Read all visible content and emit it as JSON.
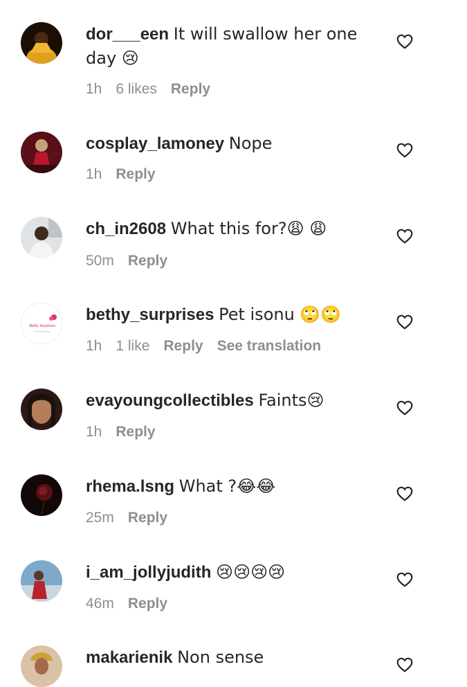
{
  "comments": [
    {
      "username": "dor___een",
      "text": "It will swallow her one day 😢",
      "time": "1h",
      "likes": "6 likes",
      "reply": "Reply",
      "extra": ""
    },
    {
      "username": "cosplay_lamoney",
      "text": "Nope",
      "time": "1h",
      "likes": "",
      "reply": "Reply",
      "extra": ""
    },
    {
      "username": "ch_in2608",
      "text": "What this for?😩 😩",
      "time": "50m",
      "likes": "",
      "reply": "Reply",
      "extra": ""
    },
    {
      "username": "bethy_surprises",
      "text": "Pet isonu 🙄🙄",
      "time": "1h",
      "likes": "1 like",
      "reply": "Reply",
      "extra": "See translation"
    },
    {
      "username": "evayoungcollectibles",
      "text": "Faints😢",
      "time": "1h",
      "likes": "",
      "reply": "Reply",
      "extra": ""
    },
    {
      "username": "rhema.lsng",
      "text": "What ?😂😂",
      "time": "25m",
      "likes": "",
      "reply": "Reply",
      "extra": ""
    },
    {
      "username": "i_am_jollyjudith",
      "text": "😢😢😢😢",
      "time": "46m",
      "likes": "",
      "reply": "Reply",
      "extra": ""
    },
    {
      "username": "makarienik",
      "text": "Non sense",
      "time": "",
      "likes": "",
      "reply": "",
      "extra": ""
    }
  ],
  "avatar_logo_text": "Bethy Surprises",
  "icons": {
    "like": "heart-outline-icon"
  },
  "colors": {
    "text": "#262626",
    "secondary": "#8e8e8e",
    "background": "#ffffff"
  }
}
